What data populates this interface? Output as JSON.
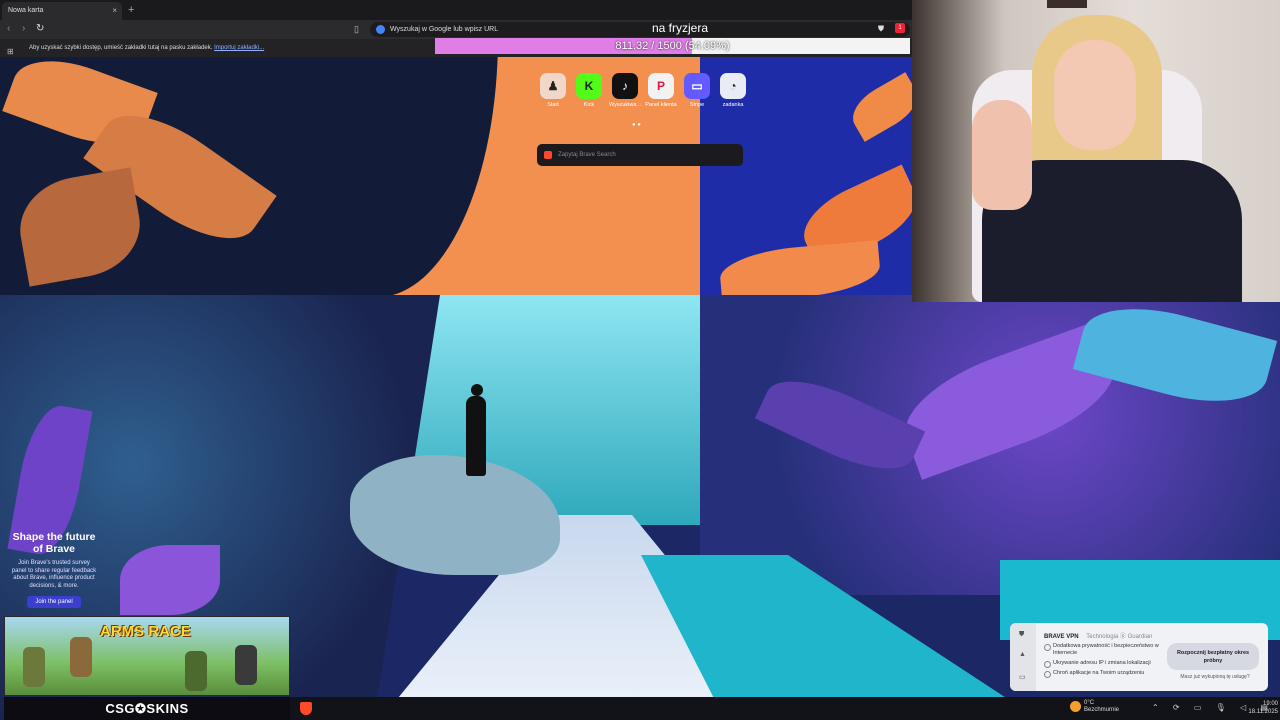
{
  "browser": {
    "tab_title": "Nowa karta",
    "new_tab_symbol": "+",
    "close_symbol": "×",
    "address_placeholder": "Wyszukaj w Google lub wpisz URL",
    "bookmarks_hint": "Aby uzyskać szybki dostęp, umieść zakładki tutaj na pasku zakładek.",
    "bookmarks_import": "Importuj zakładki...",
    "shield_badge": "1"
  },
  "goal": {
    "title": "na fryzjera",
    "text": "811.32 / 1500 (54.09%)",
    "progress": 0.5409
  },
  "newtab": {
    "tiles": [
      {
        "label": "Start",
        "glyph": "♟",
        "color": "#f1d7c8"
      },
      {
        "label": "Kick",
        "glyph": "K",
        "color": "#53fc18"
      },
      {
        "label": "Wyszukiwa...",
        "glyph": "♪",
        "color": "#111111"
      },
      {
        "label": "Panel klienta",
        "glyph": "P",
        "color": "#f2f2f2"
      },
      {
        "label": "Stripe",
        "glyph": "▭",
        "color": "#635bff"
      },
      {
        "label": "zadanka",
        "glyph": "◔",
        "color": "#e9ecf5"
      }
    ],
    "pager_dots": "● ●",
    "search_placeholder": "Zapytaj Brave Search"
  },
  "promo": {
    "title": "Shape the future of Brave",
    "body": "Join Brave's trusted survey panel to share regular feedback about Brave, influence product decisions, & more.",
    "button": "Join the panel"
  },
  "overlay": {
    "arms_race": "ARMS RACE",
    "sponsor": "CSG✪SKINS"
  },
  "vpn": {
    "title": "BRAVE VPN",
    "subtitle": "Technologia ⓖ Guardian",
    "features": [
      "Dodatkowa prywatność i bezpieczeństwo w Internecie",
      "Ukrywanie adresu IP i zmiana lokalizacji",
      "Chroń aplikacje na Twoim urządzeniu"
    ],
    "cta": "Rozpocznij bezpłatny okres próbny",
    "already": "Masz już wykupioną tę usługę?"
  },
  "taskbar": {
    "temp": "0°C",
    "weather": "Bezchmurnie",
    "tray_icons": "⌃ ⟳ ▭ 🎙 ◁ ▤",
    "time": "19:00",
    "date": "18.11.2025"
  }
}
